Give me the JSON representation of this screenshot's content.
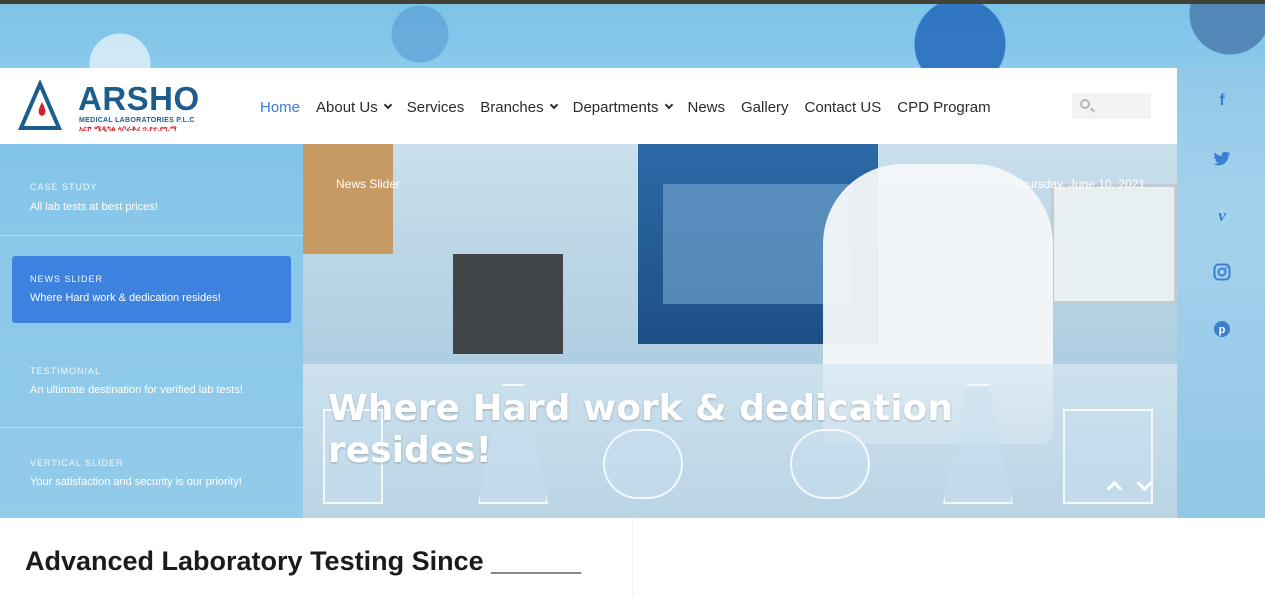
{
  "brand": {
    "name": "ARSHO",
    "subtitle": "MEDICAL LABORATORIES P.L.C",
    "amharic": "አርሾ ሜዲካል ላቦራቶሪ ኃ.የተ.የግ.ማ"
  },
  "nav": {
    "items": [
      {
        "label": "Home",
        "active": true,
        "has_dropdown": false
      },
      {
        "label": "About Us",
        "active": false,
        "has_dropdown": true
      },
      {
        "label": "Services",
        "active": false,
        "has_dropdown": false
      },
      {
        "label": "Branches",
        "active": false,
        "has_dropdown": true
      },
      {
        "label": "Departments",
        "active": false,
        "has_dropdown": true
      },
      {
        "label": "News",
        "active": false,
        "has_dropdown": false
      },
      {
        "label": "Gallery",
        "active": false,
        "has_dropdown": false
      },
      {
        "label": "Contact US",
        "active": false,
        "has_dropdown": false
      },
      {
        "label": "CPD Program",
        "active": false,
        "has_dropdown": false
      }
    ],
    "search": {
      "placeholder": "",
      "value": "",
      "icon": "search-icon"
    }
  },
  "slider": {
    "tabs": [
      {
        "label": "CASE STUDY",
        "desc": "All lab tests at best prices!",
        "active": false
      },
      {
        "label": "NEWS SLIDER",
        "desc": "Where Hard work & dedication resides!",
        "active": true
      },
      {
        "label": "TESTIMONIAL",
        "desc": "An ultimate destination for verified lab tests!",
        "active": false
      },
      {
        "label": "VERTICAL SLIDER",
        "desc": "Your satisfaction and security is our priority!",
        "active": false
      }
    ],
    "current": {
      "tag": "News Slider",
      "date": "Thursday, June 10, 2021",
      "title": "Where Hard work & dedication resides!"
    },
    "controls": {
      "up_icon": "chevron-up-icon",
      "down_icon": "chevron-down-icon"
    }
  },
  "social": {
    "icons": [
      "facebook-icon",
      "twitter-icon",
      "vimeo-icon",
      "instagram-icon",
      "pinterest-icon"
    ],
    "color": "#3a7fd0"
  },
  "section": {
    "heading": "Advanced Laboratory Testing Since ______"
  },
  "colors": {
    "accent": "#3c82de",
    "brand_blue": "#1c5d8e",
    "brand_red": "#d0242b"
  }
}
